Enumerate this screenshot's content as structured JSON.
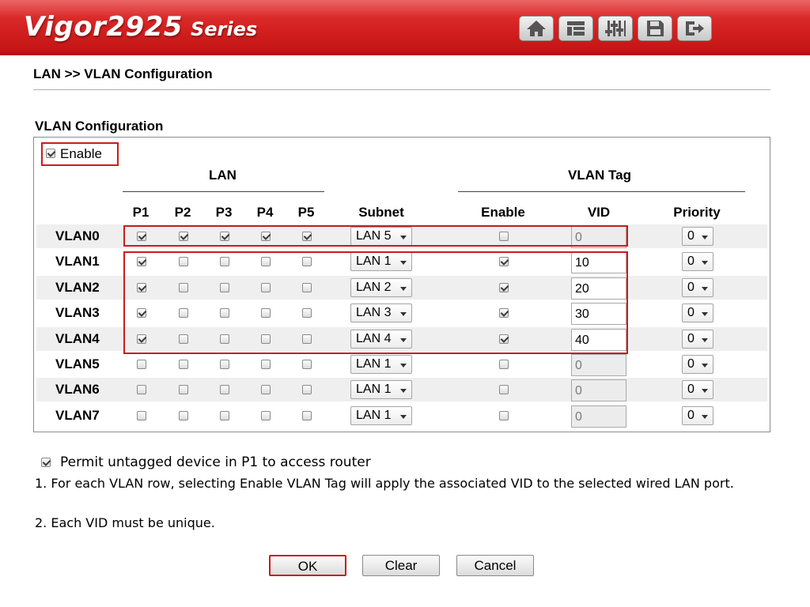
{
  "header": {
    "brand_model": "Vigor2925",
    "brand_series": "Series",
    "nav_icons": [
      "home-icon",
      "quick-start-icon",
      "settings-icon",
      "save-icon",
      "logout-icon"
    ]
  },
  "breadcrumb": "LAN >> VLAN Configuration",
  "section_title": "VLAN Configuration",
  "enable_label": "Enable",
  "enable_checked": true,
  "groups": {
    "lan": "LAN",
    "vlan_tag": "VLAN Tag"
  },
  "columns": {
    "p1": "P1",
    "p2": "P2",
    "p3": "P3",
    "p4": "P4",
    "p5": "P5",
    "subnet": "Subnet",
    "tag_enable": "Enable",
    "vid": "VID",
    "priority": "Priority"
  },
  "rows": [
    {
      "name": "VLAN0",
      "ports": [
        true,
        true,
        true,
        true,
        true
      ],
      "subnet": "LAN 5",
      "tag_enabled": false,
      "vid": "0",
      "priority": "0"
    },
    {
      "name": "VLAN1",
      "ports": [
        true,
        false,
        false,
        false,
        false
      ],
      "subnet": "LAN 1",
      "tag_enabled": true,
      "vid": "10",
      "priority": "0"
    },
    {
      "name": "VLAN2",
      "ports": [
        true,
        false,
        false,
        false,
        false
      ],
      "subnet": "LAN 2",
      "tag_enabled": true,
      "vid": "20",
      "priority": "0"
    },
    {
      "name": "VLAN3",
      "ports": [
        true,
        false,
        false,
        false,
        false
      ],
      "subnet": "LAN 3",
      "tag_enabled": true,
      "vid": "30",
      "priority": "0"
    },
    {
      "name": "VLAN4",
      "ports": [
        true,
        false,
        false,
        false,
        false
      ],
      "subnet": "LAN 4",
      "tag_enabled": true,
      "vid": "40",
      "priority": "0"
    },
    {
      "name": "VLAN5",
      "ports": [
        false,
        false,
        false,
        false,
        false
      ],
      "subnet": "LAN 1",
      "tag_enabled": false,
      "vid": "0",
      "priority": "0"
    },
    {
      "name": "VLAN6",
      "ports": [
        false,
        false,
        false,
        false,
        false
      ],
      "subnet": "LAN 1",
      "tag_enabled": false,
      "vid": "0",
      "priority": "0"
    },
    {
      "name": "VLAN7",
      "ports": [
        false,
        false,
        false,
        false,
        false
      ],
      "subnet": "LAN 1",
      "tag_enabled": false,
      "vid": "0",
      "priority": "0"
    }
  ],
  "permit_label": "Permit untagged device in P1 to access router",
  "permit_checked": true,
  "notes": [
    "1. For each VLAN row, selecting Enable VLAN Tag will apply the associated VID to the selected wired LAN port.",
    "2. Each VID must be unique."
  ],
  "buttons": {
    "ok": "OK",
    "clear": "Clear",
    "cancel": "Cancel"
  },
  "colors": {
    "banner_red": "#d42020",
    "highlight_red": "#c91d1d",
    "row_shade": "#efefef"
  }
}
